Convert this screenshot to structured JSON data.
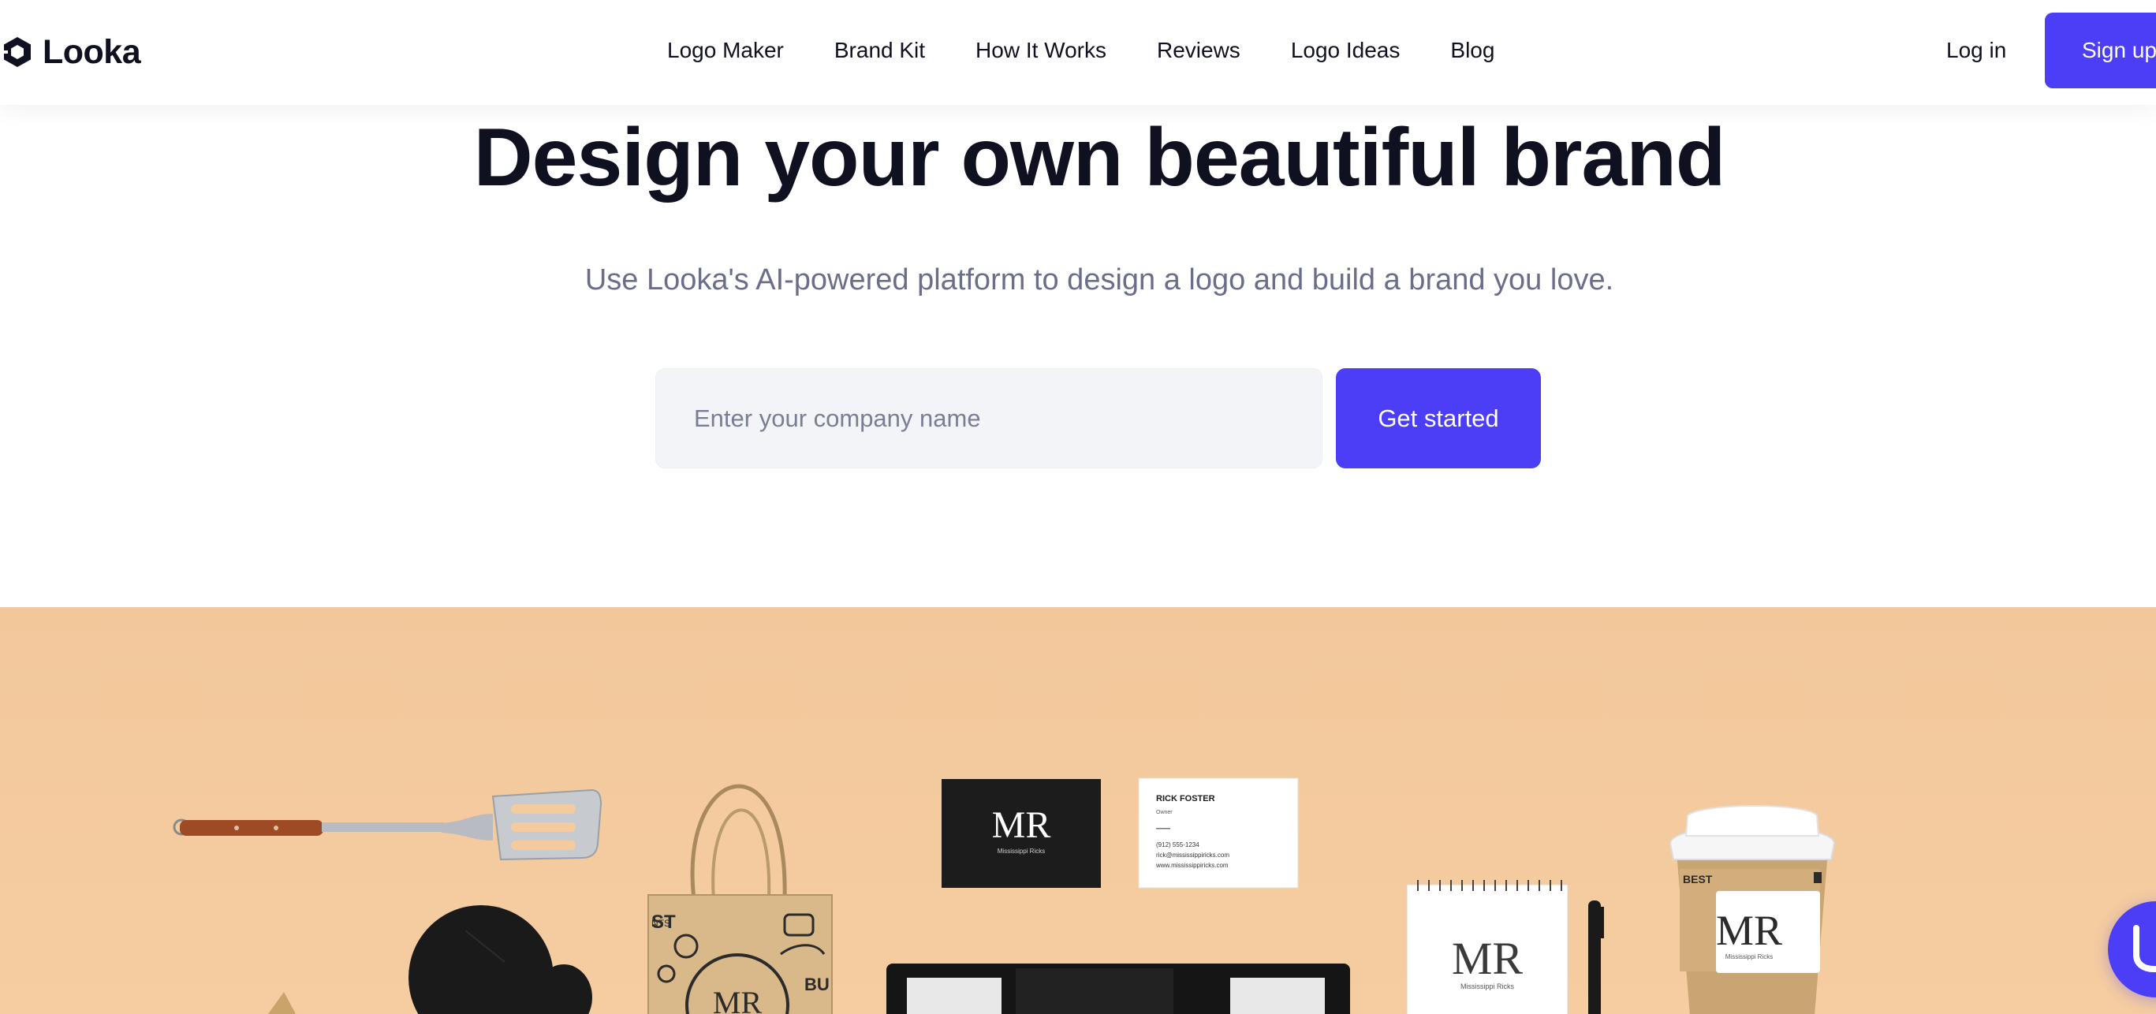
{
  "header": {
    "brand": "Looka",
    "nav": [
      {
        "label": "Logo Maker"
      },
      {
        "label": "Brand Kit"
      },
      {
        "label": "How It Works"
      },
      {
        "label": "Reviews"
      },
      {
        "label": "Logo Ideas"
      },
      {
        "label": "Blog"
      }
    ],
    "login_label": "Log in",
    "signup_label": "Sign up"
  },
  "hero": {
    "title": "Design your own beautiful brand",
    "subtitle": "Use Looka's AI-powered platform to design a logo and build a brand you love.",
    "input_placeholder": "Enter your company name",
    "cta_label": "Get started"
  },
  "showcase": {
    "monogram": "MR",
    "brand_name": "Mississippi Ricks",
    "card": {
      "name": "RICK FOSTER",
      "role": "Owner",
      "phone": "(912) 555-1234",
      "email": "rick@mississippiricks.com",
      "website": "www.mississippiricks.com"
    },
    "cup_text": "BEST",
    "bag_text_1": "ST",
    "bag_text_2": "NTS",
    "bag_text_3": "BU"
  },
  "colors": {
    "accent": "#4c3ef7",
    "text": "#0f1020",
    "muted": "#6b6e8a",
    "showcase_bg": "#f4cb9e"
  },
  "icons": {
    "logo": "looka-logo-icon",
    "chat": "chat-icon"
  }
}
